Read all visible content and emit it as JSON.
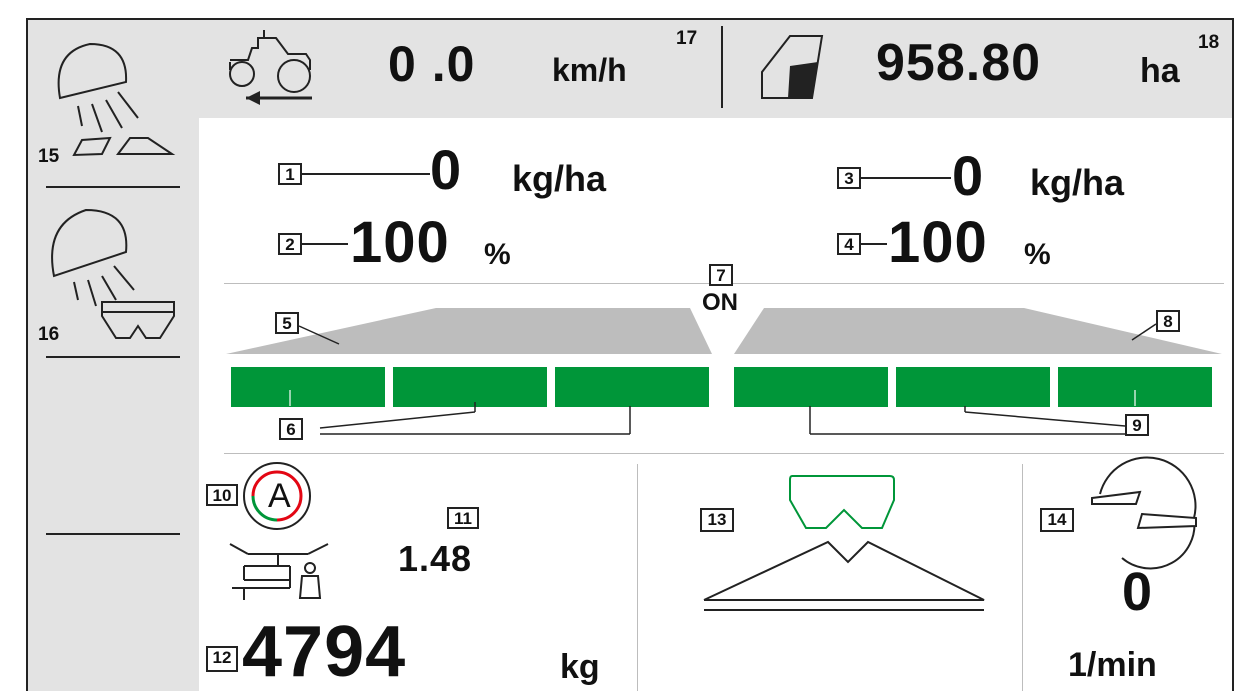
{
  "header": {
    "speed_value": "0 .0",
    "speed_unit": "km/h",
    "speed_marker": "17",
    "area_value": "958.80",
    "area_unit": "ha",
    "area_marker": "18"
  },
  "sidebar": {
    "items": [
      {
        "marker": "15",
        "icon": "headland-spread-icon"
      },
      {
        "marker": "16",
        "icon": "hopper-spread-icon"
      },
      {
        "marker": "",
        "icon": "empty-softkey"
      }
    ]
  },
  "rates": {
    "left_rate_marker": "1",
    "left_rate_value": "0",
    "left_rate_unit": "kg/ha",
    "left_pct_marker": "2",
    "left_pct_value": "100",
    "left_pct_unit": "%",
    "right_rate_marker": "3",
    "right_rate_value": "0",
    "right_rate_unit": "kg/ha",
    "right_pct_marker": "4",
    "right_pct_value": "100",
    "right_pct_unit": "%"
  },
  "boom": {
    "left_marker": "5",
    "left_sections_marker": "6",
    "status_marker": "7",
    "status_text": "ON",
    "right_marker": "8",
    "right_sections_marker": "9",
    "left_sections": [
      "on",
      "on",
      "on"
    ],
    "right_sections": [
      "on",
      "on",
      "on"
    ],
    "section_color": "#009639"
  },
  "bottom": {
    "auto_marker": "10",
    "auto_letter": "A",
    "factor_marker": "11",
    "factor_value": "1.48",
    "weight_marker": "12",
    "weight_value": "4794",
    "weight_unit": "kg",
    "spread_pattern_marker": "13",
    "rpm_marker": "14",
    "rpm_value": "0",
    "rpm_unit": "1/min"
  }
}
